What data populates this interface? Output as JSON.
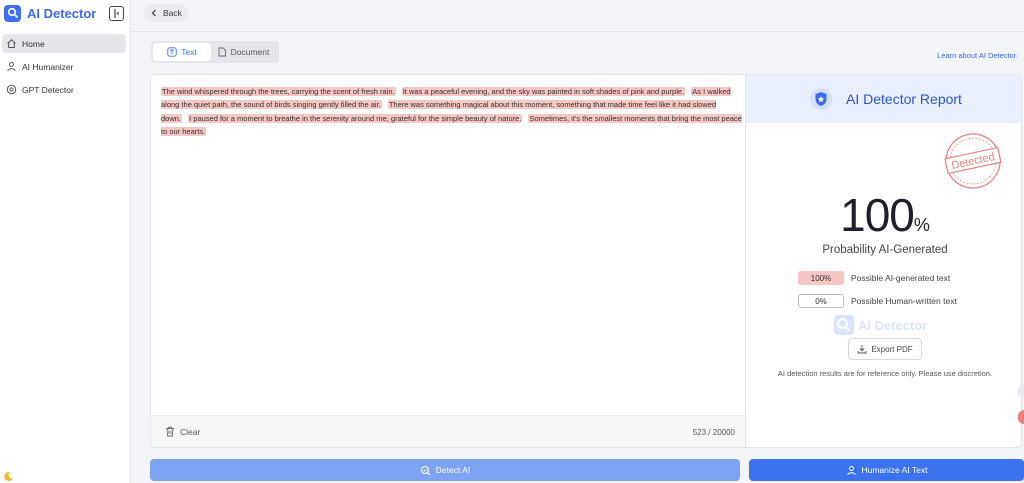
{
  "app": {
    "name": "AI Detector"
  },
  "sidebar": {
    "items": [
      {
        "label": "Home",
        "icon": "home-icon",
        "active": true
      },
      {
        "label": "AI Humanizer",
        "icon": "humanizer-icon",
        "active": false
      },
      {
        "label": "GPT Detector",
        "icon": "gpt-icon",
        "active": false
      }
    ]
  },
  "topbar": {
    "back_label": "Back"
  },
  "tabs": [
    {
      "label": "Text",
      "icon": "text-icon",
      "active": true
    },
    {
      "label": "Document",
      "icon": "document-icon",
      "active": false
    }
  ],
  "learn_link": "Learn about AI Detector.",
  "editor": {
    "sentences": [
      "The wind whispered through the trees, carrying the scent of fresh rain.",
      "It was a peaceful evening, and the sky was painted in soft shades of pink and purple.",
      "As I walked along the quiet path, the sound of birds singing gently filled the air.",
      "There was something magical about this moment, something that made time feel like it had slowed down.",
      "I paused for a moment to breathe in the serenity around me, grateful for the simple beauty of nature.",
      "Sometimes, it's the smallest moments that bring the most peace to our hearts."
    ],
    "clear_label": "Clear",
    "char_count": "523 / 20000"
  },
  "report": {
    "title": "AI Detector Report",
    "stamp_text": "Detected",
    "probability_value": "100",
    "probability_unit": "%",
    "probability_label": "Probability AI-Generated",
    "ai_pct": "100%",
    "ai_label": "Possible AI-generated text",
    "human_pct": "0%",
    "human_label": "Possible Human-written text",
    "watermark": "AI Detector",
    "export_label": "Export PDF",
    "disclaimer": "AI detection results are for reference only. Please use discretion."
  },
  "actions": {
    "detect_label": "Detect AI",
    "humanize_label": "Humanize AI Text"
  },
  "colors": {
    "accent": "#3b6cf0",
    "highlight": "#f6c6c4",
    "detect_button": "#7ea3f3",
    "humanize_button": "#3b72ee",
    "stamp": "#e05a5a"
  }
}
